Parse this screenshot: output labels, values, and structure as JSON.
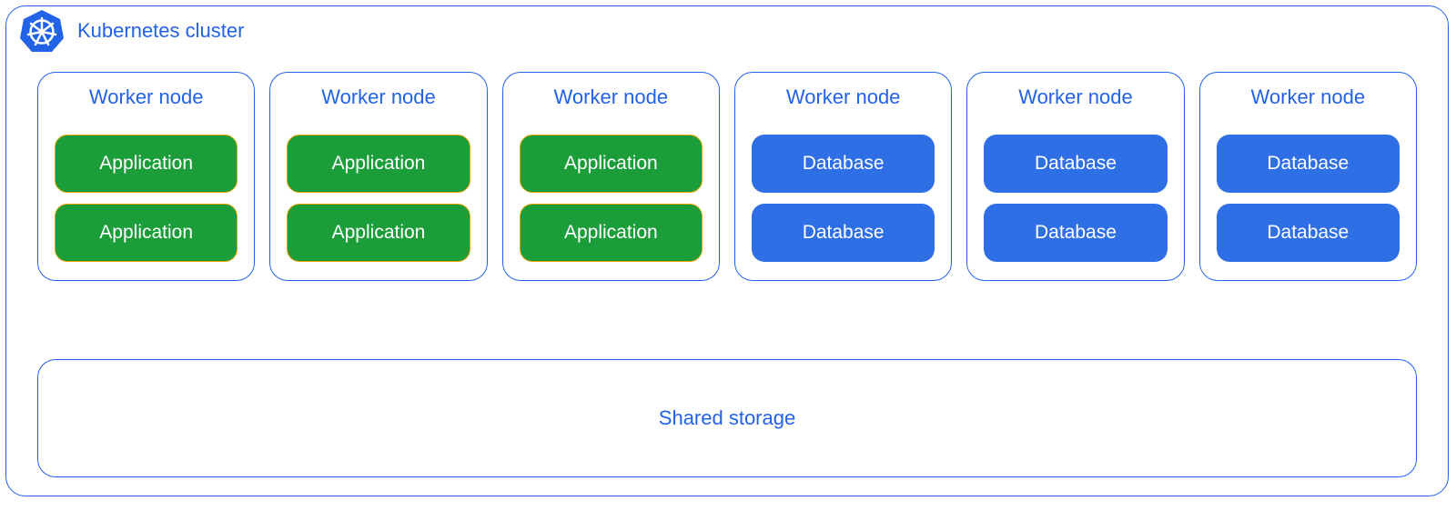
{
  "cluster": {
    "title": "Kubernetes cluster",
    "icon": "kubernetes-icon"
  },
  "nodes": [
    {
      "title": "Worker node",
      "pods": [
        {
          "type": "app",
          "label": "Application"
        },
        {
          "type": "app",
          "label": "Application"
        }
      ]
    },
    {
      "title": "Worker node",
      "pods": [
        {
          "type": "app",
          "label": "Application"
        },
        {
          "type": "app",
          "label": "Application"
        }
      ]
    },
    {
      "title": "Worker node",
      "pods": [
        {
          "type": "app",
          "label": "Application"
        },
        {
          "type": "app",
          "label": "Application"
        }
      ]
    },
    {
      "title": "Worker node",
      "pods": [
        {
          "type": "db",
          "label": "Database"
        },
        {
          "type": "db",
          "label": "Database"
        }
      ]
    },
    {
      "title": "Worker node",
      "pods": [
        {
          "type": "db",
          "label": "Database"
        },
        {
          "type": "db",
          "label": "Database"
        }
      ]
    },
    {
      "title": "Worker node",
      "pods": [
        {
          "type": "db",
          "label": "Database"
        },
        {
          "type": "db",
          "label": "Database"
        }
      ]
    }
  ],
  "shared_storage": {
    "label": "Shared storage"
  },
  "colors": {
    "outline": "#2262e6",
    "app_bg": "#1b9e3a",
    "app_border": "#e6a100",
    "db_bg": "#2f6fe6",
    "text_light": "#ffffff"
  }
}
